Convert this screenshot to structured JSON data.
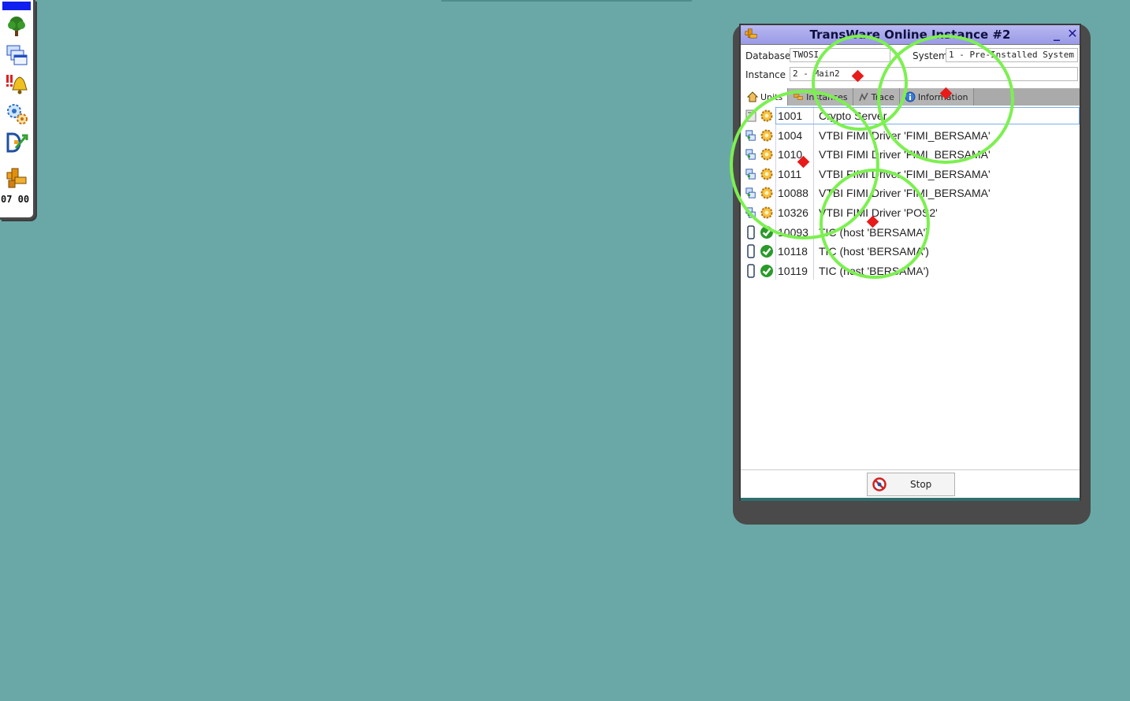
{
  "desktop": {
    "background": "#6aa8a8"
  },
  "dock": {
    "items": [
      {
        "icon": "tree-icon"
      },
      {
        "icon": "windows-icon"
      },
      {
        "icon": "alarm-bell-icon"
      },
      {
        "icon": "gears-icon"
      },
      {
        "icon": "diagram-icon"
      },
      {
        "icon": "transware-icon"
      }
    ],
    "clock": "07 00"
  },
  "window": {
    "title": "TransWare Online Instance #2",
    "minimize_label": "_",
    "close_label": "✕",
    "database_label": "Database",
    "database_value": "TWOSI",
    "system_label": "System",
    "system_value": "1 - Pre-Installed System",
    "instance_label": "Instance",
    "instance_value": "2 - Main2",
    "tabs": [
      {
        "label": "Units",
        "icon": "home-icon"
      },
      {
        "label": "Instances",
        "icon": "transware-icon"
      },
      {
        "label": "Trace",
        "icon": "trace-icon"
      },
      {
        "label": "Information",
        "icon": "info-icon"
      }
    ],
    "units": [
      {
        "id": "1001",
        "name": "Crypto Server",
        "type": "unit",
        "status": "gear"
      },
      {
        "id": "1004",
        "name": "VTBI FIMI Driver 'FIMI_BERSAMA'",
        "type": "network",
        "status": "gear"
      },
      {
        "id": "1010",
        "name": "VTBI FIMI Driver 'FIMI_BERSAMA'",
        "type": "network",
        "status": "gear"
      },
      {
        "id": "1011",
        "name": "VTBI FIMI Driver 'FIMI_BERSAMA'",
        "type": "network",
        "status": "gear"
      },
      {
        "id": "10088",
        "name": "VTBI FIMI Driver 'FIMI_BERSAMA'",
        "type": "network",
        "status": "gear"
      },
      {
        "id": "10326",
        "name": "VTBI FIMI Driver 'POS2'",
        "type": "network",
        "status": "gear"
      },
      {
        "id": "10093",
        "name": "TIC (host 'BERSAMA')",
        "type": "device",
        "status": "ok"
      },
      {
        "id": "10118",
        "name": "TIC (host 'BERSAMA')",
        "type": "device",
        "status": "ok"
      },
      {
        "id": "10119",
        "name": "TIC (host 'BERSAMA')",
        "type": "device",
        "status": "ok"
      }
    ],
    "stop_label": "Stop"
  },
  "colors": {
    "titlebar": "#a8a8ee",
    "ring": "#7cf050",
    "marker": "#e81a1a",
    "ok_green": "#2a9a2a",
    "gear_orange": "#e8a010"
  }
}
